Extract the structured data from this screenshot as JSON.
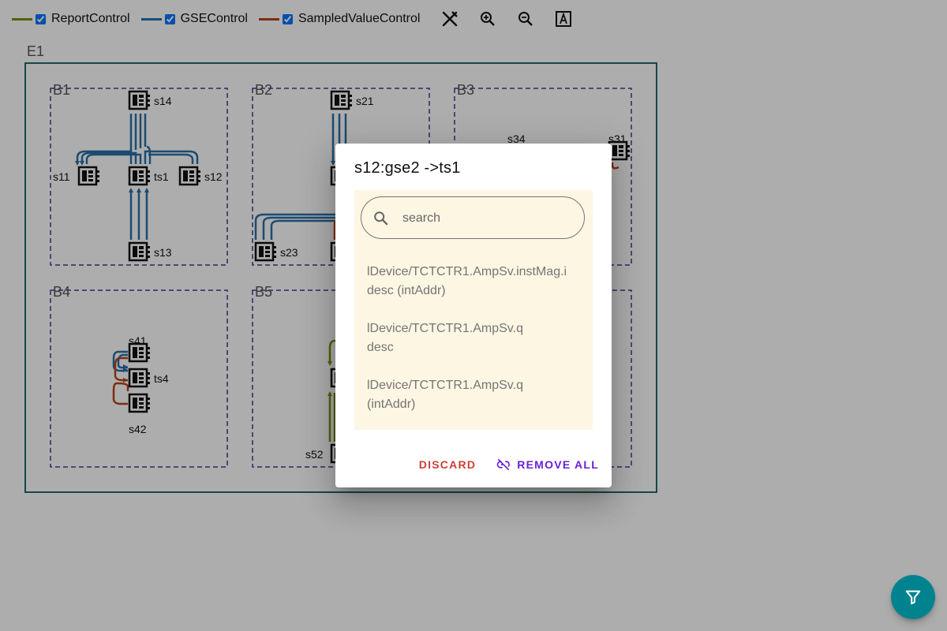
{
  "colors": {
    "report": "#7a8f0c",
    "gse": "#2a6fa8",
    "sv": "#b5451a",
    "bay_border": "#3b3b96",
    "sub_border": "#1f6a6a",
    "fab": "#00838f",
    "dialog_content_bg": "#fdf6e3"
  },
  "toolbar": {
    "legend": [
      {
        "label": "ReportControl",
        "checked": true
      },
      {
        "label": "GSEControl",
        "checked": true
      },
      {
        "label": "SampledValueControl",
        "checked": true
      }
    ],
    "icons": [
      "no-connection-icon",
      "zoom-in-icon",
      "zoom-out-icon",
      "text-label-icon"
    ]
  },
  "diagram": {
    "substation": "E1",
    "bays": {
      "b1": "B1",
      "b2": "B2",
      "b3": "B3",
      "b4": "B4",
      "b5": "B5"
    },
    "ieds": {
      "s14": "s14",
      "s11": "s11",
      "ts1": "ts1",
      "s12": "s12",
      "s13": "s13",
      "s21": "s21",
      "s23": "s23",
      "s34": "s34",
      "s31": "s31",
      "s41": "s41",
      "ts4": "ts4",
      "s42": "s42",
      "s52": "s52"
    }
  },
  "dialog": {
    "title": "s12:gse2 ->ts1",
    "search_placeholder": "search",
    "items": [
      {
        "line1": "lDevice/TCTCTR1.AmpSv.instMag.i",
        "line2": "desc (intAddr)"
      },
      {
        "line1": "lDevice/TCTCTR1.AmpSv.q",
        "line2": "desc"
      },
      {
        "line1": "lDevice/TCTCTR1.AmpSv.q",
        "line2": "(intAddr)"
      }
    ],
    "discard_label": "Discard",
    "remove_all_label": "Remove all"
  },
  "fab": {
    "icon": "filter-icon"
  }
}
